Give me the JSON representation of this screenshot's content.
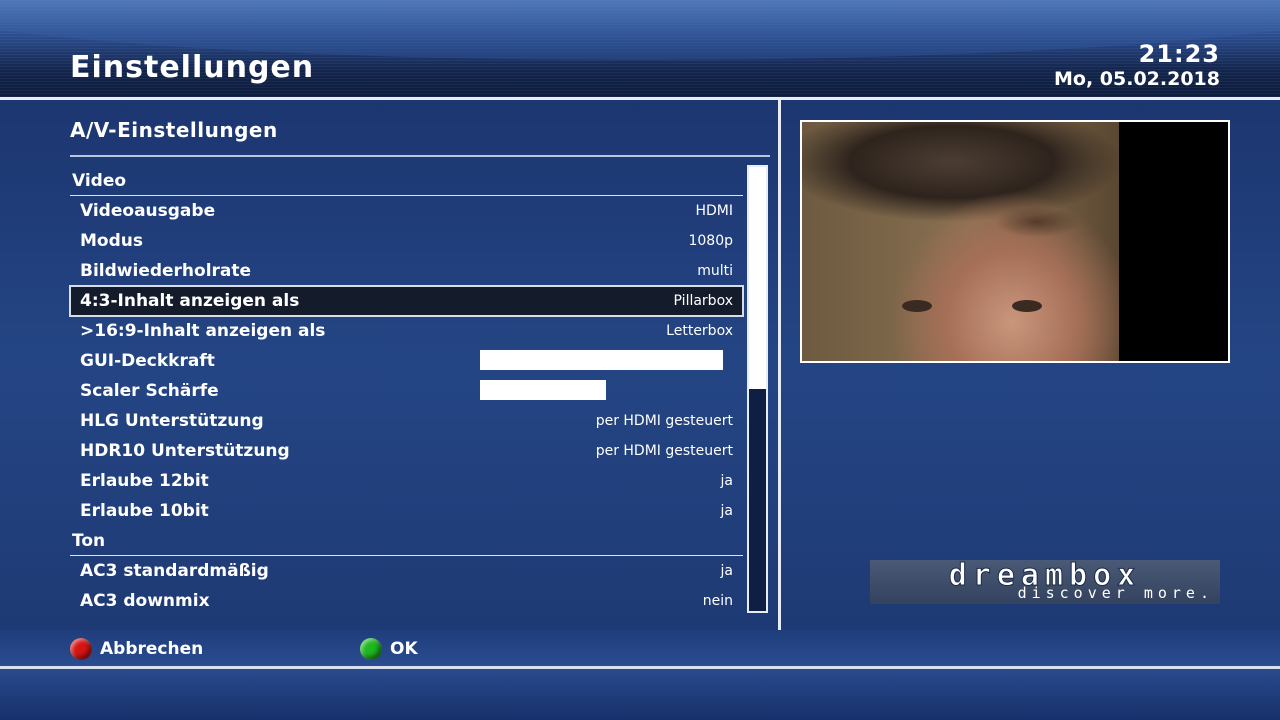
{
  "header": {
    "title": "Einstellungen",
    "time": "21:23",
    "date": "Mo, 05.02.2018"
  },
  "panel": {
    "subtitle": "A/V-Einstellungen"
  },
  "sections": {
    "video": "Video",
    "ton": "Ton"
  },
  "settings": [
    {
      "label": "Videoausgabe",
      "value": "HDMI"
    },
    {
      "label": "Modus",
      "value": "1080p"
    },
    {
      "label": "Bildwiederholrate",
      "value": "multi"
    },
    {
      "label": "4:3-Inhalt anzeigen als",
      "value": "Pillarbox",
      "selected": true
    },
    {
      "label": ">16:9-Inhalt anzeigen als",
      "value": "Letterbox"
    },
    {
      "label": "GUI-Deckkraft",
      "level": 1.0
    },
    {
      "label": "Scaler Schärfe",
      "level": 0.52
    },
    {
      "label": "HLG Unterstützung",
      "value": "per HDMI gesteuert"
    },
    {
      "label": "HDR10 Unterstützung",
      "value": "per HDMI gesteuert"
    },
    {
      "label": "Erlaube 12bit",
      "value": "ja"
    },
    {
      "label": "Erlaube 10bit",
      "value": "ja"
    },
    {
      "label": "AC3 standardmäßig",
      "value": "ja"
    },
    {
      "label": "AC3 downmix",
      "value": "nein"
    }
  ],
  "scroll": {
    "position_fraction": 0.5
  },
  "logo": {
    "word": "dreambox",
    "tagline": "discover more."
  },
  "footer": {
    "red_label": "Abbrechen",
    "green_label": "OK"
  },
  "colors": {
    "red_button": "#d61414",
    "green_button": "#1fb71f",
    "background": "#213f79"
  }
}
